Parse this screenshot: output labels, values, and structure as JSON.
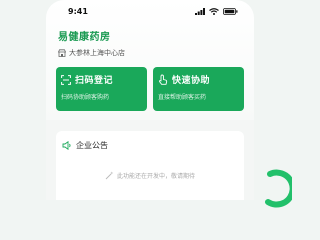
{
  "status_bar": {
    "time": "9:41"
  },
  "store": {
    "name": "易健康药房",
    "branch": "大参林上海中心店"
  },
  "actions": [
    {
      "title": "扫码登记",
      "subtitle": "扫码协助顾客购药",
      "icon": "scan-icon"
    },
    {
      "title": "快速协助",
      "subtitle": "直接帮助顾客买药",
      "icon": "tap-icon"
    }
  ],
  "notice": {
    "title": "企业公告",
    "icon": "speaker-icon",
    "empty_text": "此功能还在开发中，敬请期待",
    "empty_icon": "wand-icon"
  },
  "colors": {
    "accent": "#1aa85a",
    "title_green": "#1a9a52",
    "decor_ring": "#22c06a"
  }
}
